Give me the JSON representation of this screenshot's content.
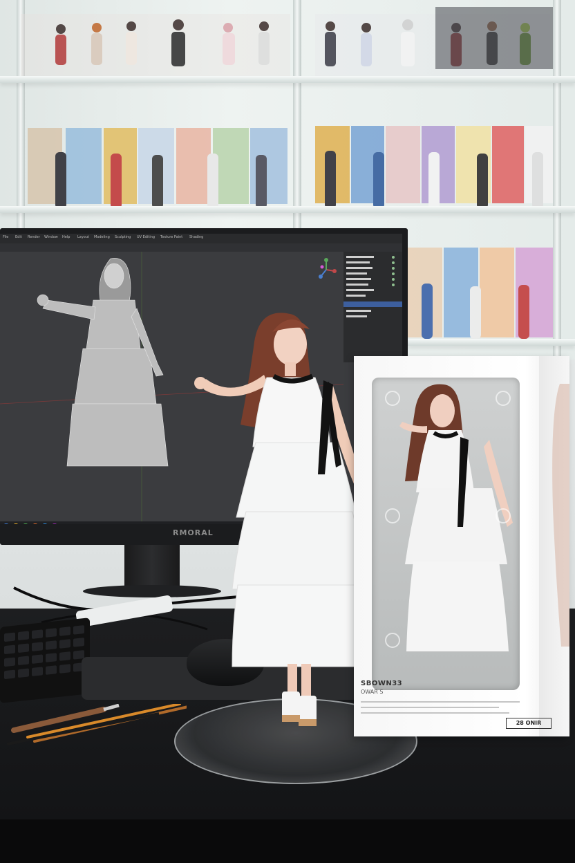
{
  "monitor": {
    "brand": "RMORAL",
    "menu": [
      "File",
      "Edit",
      "Render",
      "Window",
      "Help",
      "Layout",
      "Modeling",
      "Sculpting",
      "UV Editing",
      "Texture Paint",
      "Shading"
    ]
  },
  "product_box": {
    "title": "SBOWN33",
    "subtitle": "OWAR S",
    "code": "28 ONIR"
  },
  "colors": {
    "desk": "#131416",
    "box": "#f8f8f8",
    "dress": "#f6f7f7",
    "hair": "#7a3e2c",
    "ribbon": "#121212",
    "viewport": "#3b3c3f"
  }
}
